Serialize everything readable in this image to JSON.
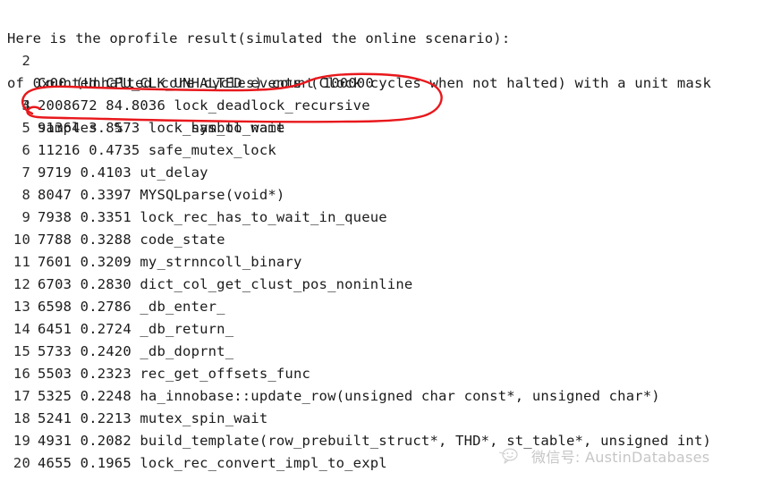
{
  "screenshot": {
    "background_color": "#ffffff",
    "text_color": "#1b1b1b",
    "annotation_color": "#e8181c",
    "watermark_color": "#c6c6c6"
  },
  "terminal": {
    "header_lines": [
      {
        "gutter": "",
        "text": "Here is the oprofile result(simulated the online scenario):"
      },
      {
        "gutter": "2",
        "text": "Counted CPU_CLK_UNHALTED events (Clock cycles when not halted) with a unit mask"
      },
      {
        "gutter": "",
        "text": "of 0x00 (Unhalted core cycles) count 100000"
      }
    ],
    "column_header": {
      "gutter": "3",
      "text": "samples  %        symbol name"
    },
    "rows": [
      {
        "gutter": "4",
        "samples": "2008672",
        "percent": "84.8036",
        "symbol": "lock_deadlock_recursive",
        "highlighted": true
      },
      {
        "gutter": "5",
        "samples": "91364",
        "percent": "3.8573",
        "symbol": "lock_has_to_wait",
        "highlighted": false
      },
      {
        "gutter": "6",
        "samples": "11216",
        "percent": "0.4735",
        "symbol": "safe_mutex_lock",
        "highlighted": false
      },
      {
        "gutter": "7",
        "samples": "9719",
        "percent": "0.4103",
        "symbol": "ut_delay",
        "highlighted": false
      },
      {
        "gutter": "8",
        "samples": "8047",
        "percent": "0.3397",
        "symbol": "MYSQLparse(void*)",
        "highlighted": false
      },
      {
        "gutter": "9",
        "samples": "7938",
        "percent": "0.3351",
        "symbol": "lock_rec_has_to_wait_in_queue",
        "highlighted": false
      },
      {
        "gutter": "10",
        "samples": "7788",
        "percent": "0.3288",
        "symbol": "code_state",
        "highlighted": false
      },
      {
        "gutter": "11",
        "samples": "7601",
        "percent": "0.3209",
        "symbol": "my_strnncoll_binary",
        "highlighted": false
      },
      {
        "gutter": "12",
        "samples": "6703",
        "percent": "0.2830",
        "symbol": "dict_col_get_clust_pos_noninline",
        "highlighted": false
      },
      {
        "gutter": "13",
        "samples": "6598",
        "percent": "0.2786",
        "symbol": "_db_enter_",
        "highlighted": false
      },
      {
        "gutter": "14",
        "samples": "6451",
        "percent": "0.2724",
        "symbol": "_db_return_",
        "highlighted": false
      },
      {
        "gutter": "15",
        "samples": "5733",
        "percent": "0.2420",
        "symbol": "_db_doprnt_",
        "highlighted": false
      },
      {
        "gutter": "16",
        "samples": "5503",
        "percent": "0.2323",
        "symbol": "rec_get_offsets_func",
        "highlighted": false
      },
      {
        "gutter": "17",
        "samples": "5325",
        "percent": "0.2248",
        "symbol": "ha_innobase::update_row(unsigned char const*, unsigned char*)",
        "highlighted": false
      },
      {
        "gutter": "18",
        "samples": "5241",
        "percent": "0.2213",
        "symbol": "mutex_spin_wait",
        "highlighted": false
      },
      {
        "gutter": "19",
        "samples": "4931",
        "percent": "0.2082",
        "symbol": "build_template(row_prebuilt_struct*, THD*, st_table*, unsigned int)",
        "highlighted": false
      },
      {
        "gutter": "20",
        "samples": "4655",
        "percent": "0.1965",
        "symbol": "lock_rec_convert_impl_to_expl",
        "highlighted": false
      }
    ]
  },
  "annotation": {
    "shape": "hand-drawn-red-ellipse",
    "targets_line": "4",
    "targets_symbol": "lock_deadlock_recursive"
  },
  "watermark": {
    "icon": "wechat-icon",
    "text": "微信号: AustinDatabases"
  }
}
